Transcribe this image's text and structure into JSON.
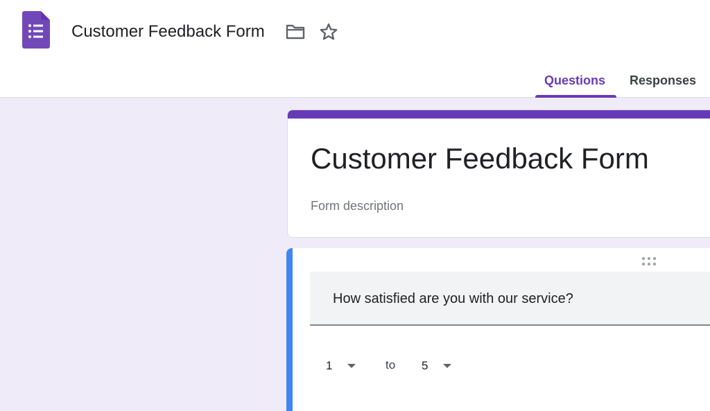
{
  "header": {
    "doc_title": "Customer Feedback Form",
    "icons": {
      "app": "forms-logo-icon",
      "folder": "folder-icon",
      "star": "star-icon"
    },
    "tabs": [
      {
        "label": "Questions",
        "active": true
      },
      {
        "label": "Responses",
        "active": false
      }
    ]
  },
  "form": {
    "title": "Customer Feedback Form",
    "description_placeholder": "Form description"
  },
  "question": {
    "text": "How satisfied are you with our service?",
    "scale": {
      "low": "1",
      "to_label": "to",
      "high": "5"
    }
  },
  "colors": {
    "accent": "#673ab7",
    "background": "#f0ebf8",
    "active_question_bar": "#4285f4"
  }
}
